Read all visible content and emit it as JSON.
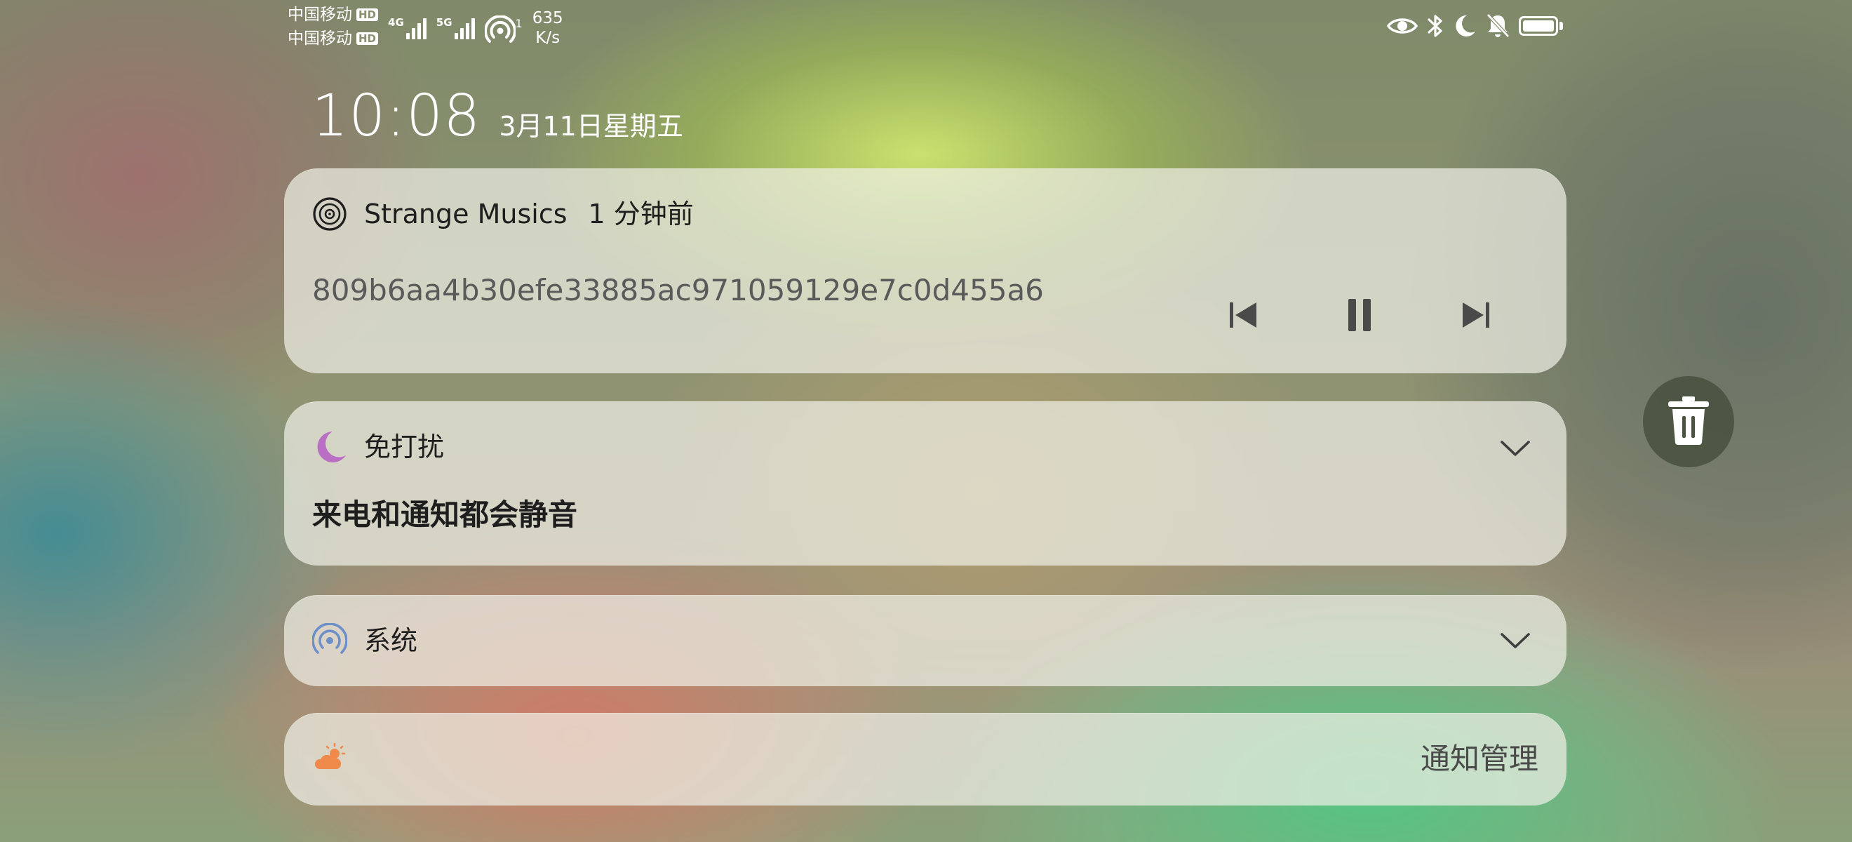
{
  "status_bar": {
    "carriers": [
      {
        "name": "中国移动",
        "badge": "HD"
      },
      {
        "name": "中国移动",
        "badge": "HD"
      }
    ],
    "sim1_network": "4G",
    "sim2_network": "5G",
    "hotspot_count": "1",
    "speed_value": "635",
    "speed_unit": "K/s",
    "icons": [
      "eye-icon",
      "bluetooth-icon",
      "moon-icon",
      "bell-off-icon",
      "battery-icon"
    ]
  },
  "clock": {
    "time": "10:08",
    "date": "3月11日星期五"
  },
  "music_notification": {
    "app_name": "Strange Musics",
    "time_ago": "1 分钟前",
    "track": "809b6aa4b30efe33885ac971059129e7c0d455a6",
    "controls": [
      "previous",
      "pause",
      "next"
    ]
  },
  "dnd_notification": {
    "title": "免打扰",
    "body": "来电和通知都会静音",
    "icon_color": "#b86fc4"
  },
  "system_notification": {
    "title": "系统",
    "icon_color": "#6f8fc8"
  },
  "manage": {
    "label": "通知管理",
    "icon_color": "#f08a4b"
  }
}
